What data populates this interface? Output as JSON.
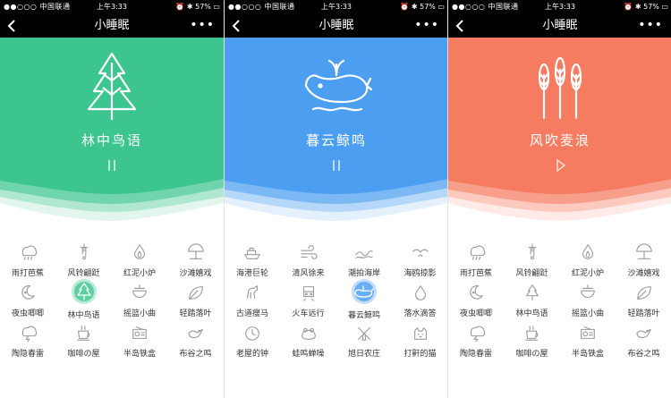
{
  "colors": {
    "green": "#3dc58f",
    "blue": "#4c9ff0",
    "orange": "#f57c60"
  },
  "screens": [
    {
      "status": {
        "carrier": "●●○○○ 中国联通",
        "time": "上午3:33",
        "right": "57%"
      },
      "nav": {
        "title": "小睡眠",
        "more": "•••"
      },
      "hero": {
        "title": "林中鸟语",
        "control": "pause",
        "icon": "pine-tree-icon",
        "color": "#3dc58f"
      },
      "sounds": [
        {
          "label": "雨打芭蕉",
          "icon": "rain-icon"
        },
        {
          "label": "风铃翩跹",
          "icon": "wind-chime-icon"
        },
        {
          "label": "红泥小炉",
          "icon": "flame-icon"
        },
        {
          "label": "沙滩嬉戏",
          "icon": "beach-umbrella-icon"
        },
        {
          "label": "夜虫唧唧",
          "icon": "moon-icon"
        },
        {
          "label": "林中鸟语",
          "icon": "pine-tree-icon",
          "active": true
        },
        {
          "label": "摇篮小曲",
          "icon": "cradle-icon"
        },
        {
          "label": "轻踏落叶",
          "icon": "leaf-icon"
        },
        {
          "label": "陶隐春雷",
          "icon": "thunder-cloud-icon"
        },
        {
          "label": "咖啡の屋",
          "icon": "coffee-cup-icon"
        },
        {
          "label": "半岛铁盒",
          "icon": "radio-icon"
        },
        {
          "label": "布谷之鸣",
          "icon": "bird-icon"
        }
      ]
    },
    {
      "status": {
        "carrier": "●●○○○ 中国联通",
        "time": "上午3:33",
        "right": "57%"
      },
      "nav": {
        "title": "小睡眠",
        "more": "•••"
      },
      "hero": {
        "title": "暮云鲸鸣",
        "control": "pause",
        "icon": "whale-icon",
        "color": "#4c9ff0"
      },
      "sounds": [
        {
          "label": "海港巨轮",
          "icon": "ship-icon"
        },
        {
          "label": "清风徐来",
          "icon": "wind-icon"
        },
        {
          "label": "潮拍海岸",
          "icon": "wave-icon"
        },
        {
          "label": "海鸥掠影",
          "icon": "seagull-icon"
        },
        {
          "label": "古道瘦马",
          "icon": "horse-icon"
        },
        {
          "label": "火车远行",
          "icon": "train-icon"
        },
        {
          "label": "暮云鲸鸣",
          "icon": "whale-icon",
          "active": true
        },
        {
          "label": "落水滴答",
          "icon": "water-drop-icon"
        },
        {
          "label": "老屋的钟",
          "icon": "clock-icon"
        },
        {
          "label": "蛙鸣蝉噪",
          "icon": "frog-icon"
        },
        {
          "label": "旭日农庄",
          "icon": "windmill-icon"
        },
        {
          "label": "打鼾的猫",
          "icon": "cat-icon"
        }
      ]
    },
    {
      "status": {
        "carrier": "●●○○○ 中国联通",
        "time": "上午3:33",
        "right": "57%"
      },
      "nav": {
        "title": "小睡眠",
        "more": "•••"
      },
      "hero": {
        "title": "风吹麦浪",
        "control": "play",
        "icon": "wheat-icon",
        "color": "#f57c60"
      },
      "sounds": [
        {
          "label": "雨打芭蕉",
          "icon": "rain-icon"
        },
        {
          "label": "风铃翩跹",
          "icon": "wind-chime-icon"
        },
        {
          "label": "红泥小炉",
          "icon": "flame-icon"
        },
        {
          "label": "沙滩嬉戏",
          "icon": "beach-umbrella-icon"
        },
        {
          "label": "夜虫唧唧",
          "icon": "moon-icon"
        },
        {
          "label": "林中鸟语",
          "icon": "pine-tree-icon"
        },
        {
          "label": "摇篮小曲",
          "icon": "cradle-icon"
        },
        {
          "label": "轻踏落叶",
          "icon": "leaf-icon"
        },
        {
          "label": "陶隐春雷",
          "icon": "thunder-cloud-icon"
        },
        {
          "label": "咖啡の屋",
          "icon": "coffee-cup-icon"
        },
        {
          "label": "半岛铁盒",
          "icon": "radio-icon"
        },
        {
          "label": "布谷之鸣",
          "icon": "bird-icon"
        }
      ]
    }
  ]
}
